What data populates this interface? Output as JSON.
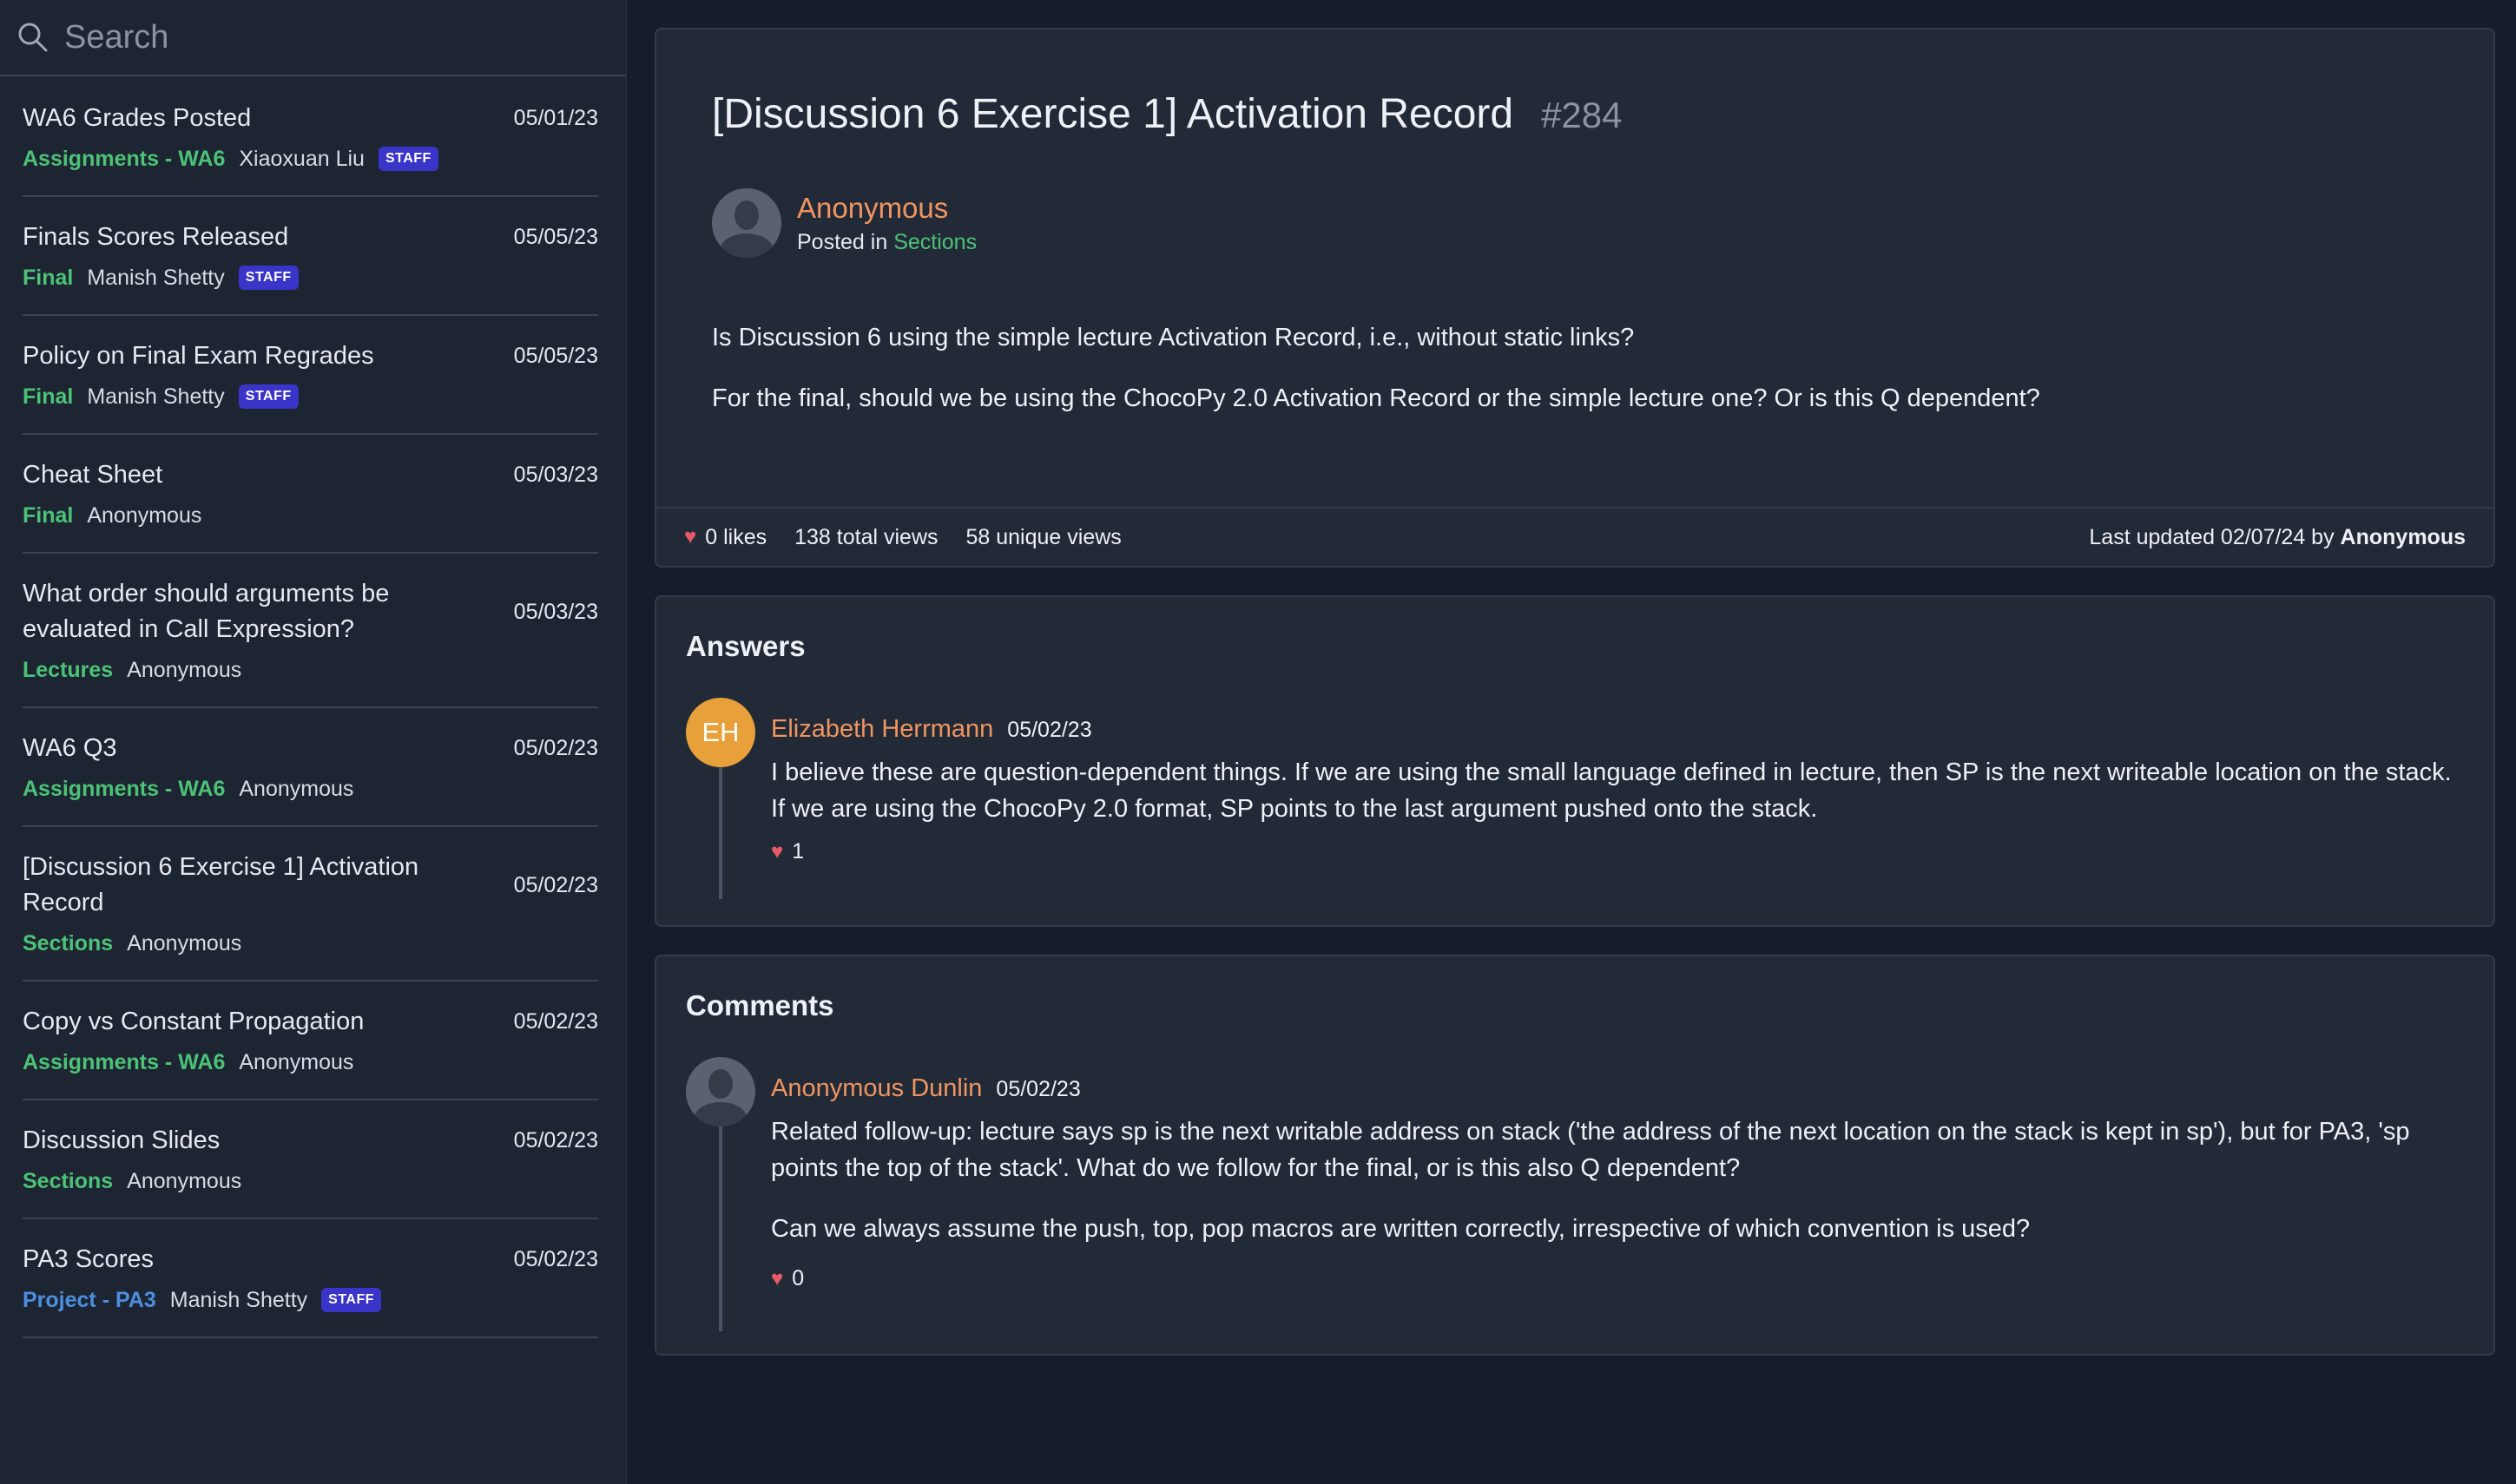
{
  "search": {
    "placeholder": "Search"
  },
  "sidebar": {
    "posts": [
      {
        "title": "WA6 Grades Posted",
        "date": "05/01/23",
        "category": "Assignments - WA6",
        "category_color": "green",
        "author": "Xiaoxuan Liu",
        "badge": "STAFF"
      },
      {
        "title": "Finals Scores Released",
        "date": "05/05/23",
        "category": "Final",
        "category_color": "green",
        "author": "Manish Shetty",
        "badge": "STAFF"
      },
      {
        "title": "Policy on Final Exam Regrades",
        "date": "05/05/23",
        "category": "Final",
        "category_color": "green",
        "author": "Manish Shetty",
        "badge": "STAFF"
      },
      {
        "title": "Cheat Sheet",
        "date": "05/03/23",
        "category": "Final",
        "category_color": "green",
        "author": "Anonymous",
        "badge": ""
      },
      {
        "title": "What order should arguments be evaluated in Call Expression?",
        "date": "05/03/23",
        "category": "Lectures",
        "category_color": "green",
        "author": "Anonymous",
        "badge": ""
      },
      {
        "title": "WA6 Q3",
        "date": "05/02/23",
        "category": "Assignments - WA6",
        "category_color": "green",
        "author": "Anonymous",
        "badge": ""
      },
      {
        "title": "[Discussion 6 Exercise 1] Activation Record",
        "date": "05/02/23",
        "category": "Sections",
        "category_color": "green",
        "author": "Anonymous",
        "badge": ""
      },
      {
        "title": "Copy vs Constant Propagation",
        "date": "05/02/23",
        "category": "Assignments - WA6",
        "category_color": "green",
        "author": "Anonymous",
        "badge": ""
      },
      {
        "title": "Discussion Slides",
        "date": "05/02/23",
        "category": "Sections",
        "category_color": "green",
        "author": "Anonymous",
        "badge": ""
      },
      {
        "title": "PA3 Scores",
        "date": "05/02/23",
        "category": "Project - PA3",
        "category_color": "blue",
        "author": "Manish Shetty",
        "badge": "STAFF"
      }
    ]
  },
  "post": {
    "title": "[Discussion 6 Exercise 1] Activation Record",
    "number": "#284",
    "author": "Anonymous",
    "posted_in_label": "Posted in",
    "posted_in_section": "Sections",
    "paragraphs": [
      "Is Discussion 6 using the simple lecture Activation Record, i.e., without static links?",
      "For the final, should we be using the ChocoPy 2.0 Activation Record or the simple lecture one? Or is this Q dependent?"
    ],
    "likes": "0 likes",
    "total_views": "138 total views",
    "unique_views": "58 unique views",
    "updated_prefix": "Last updated 02/07/24 by",
    "updated_by": "Anonymous"
  },
  "answers": {
    "title": "Answers",
    "item": {
      "initials": "EH",
      "name": "Elizabeth Herrmann",
      "date": "05/02/23",
      "text": "I believe these are question-dependent things. If we are using the small language defined in lecture, then SP is the next writeable location on the stack. If we are using the ChocoPy 2.0 format, SP points to the last argument pushed onto the stack.",
      "likes": "1"
    }
  },
  "comments": {
    "title": "Comments",
    "item": {
      "name": "Anonymous Dunlin",
      "date": "05/02/23",
      "paragraphs": [
        "Related follow-up: lecture says sp is the next writable address on stack ('the address of the next location on the stack is kept in sp'), but for PA3, 'sp points the top of the stack'. What do we follow for the final, or is this also Q dependent?",
        "Can we always assume the push, top, pop macros are written correctly, irrespective of which convention is used?"
      ],
      "likes": "0"
    }
  },
  "colors": {
    "accent_orange": "#f0955f",
    "category_green": "#4cc276",
    "category_blue": "#4c8fe0",
    "staff_badge": "#3a35c8",
    "heart": "#e85a68"
  },
  "icons": {
    "search": "search-icon",
    "heart": "heart-icon",
    "avatar": "anonymous-avatar-icon"
  }
}
